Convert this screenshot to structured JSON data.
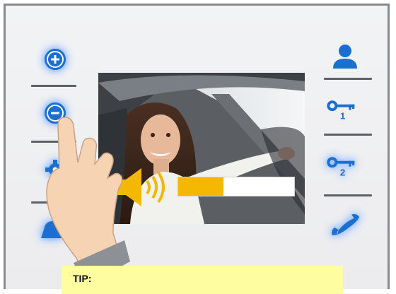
{
  "tip": {
    "label": "TIP:"
  },
  "volume": {
    "level_fraction": 0.39
  },
  "left_buttons": [
    {
      "icon": "plus-circle-icon"
    },
    {
      "icon": "minus-circle-icon"
    },
    {
      "icon": "gear-icon"
    },
    {
      "icon": "bell-icon"
    }
  ],
  "right_buttons": [
    {
      "icon": "person-icon"
    },
    {
      "icon": "key-1-icon",
      "number": "1"
    },
    {
      "icon": "key-2-icon",
      "number": "2"
    },
    {
      "icon": "phone-handset-icon"
    }
  ],
  "colors": {
    "icon_blue": "#1a6fd1",
    "glow": "#7fb0ff",
    "volume_fill": "#f5b800",
    "tip_background": "#fefea0"
  }
}
